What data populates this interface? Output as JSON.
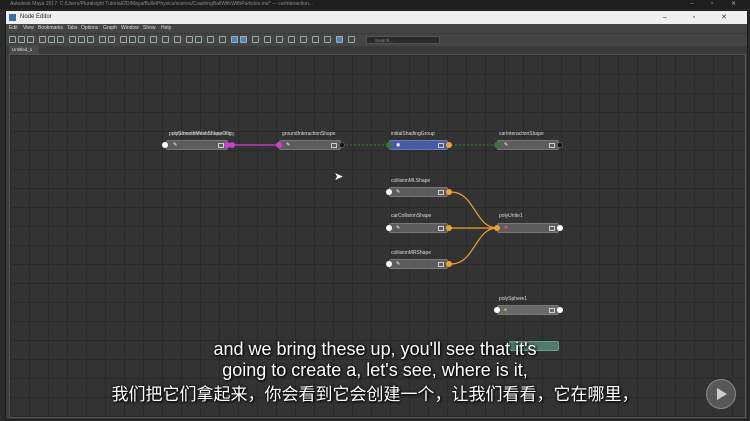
{
  "outer_window": {
    "title": "Autodesk Maya 2017: C:/Users/Pluralsight Tutorial/2D/Maya/BulletPhysics/scenes/CrashingBallWithWithParticles.ma* --- carInteraction..."
  },
  "node_editor": {
    "title": "Node Editor",
    "menu": [
      "Edit",
      "View",
      "Bookmarks",
      "Tabs",
      "Options",
      "Graph",
      "Window",
      "Show",
      "Help"
    ],
    "search": {
      "placeholder": "Search..."
    },
    "tab_label": "Untitled_1",
    "nodes": [
      {
        "label": "polySmoothMeshShapeOrig",
        "overlap_label": "polySmoothMeshShapeOrig",
        "icon": "mesh-icon"
      },
      {
        "label": "groundInteractionShape",
        "icon": "mesh-icon"
      },
      {
        "label": "initialShadingGroup",
        "icon": "shading-group-icon"
      },
      {
        "label": "carInteractionShape",
        "icon": "mesh-icon"
      },
      {
        "label": "collisionMLShape",
        "icon": "mesh-icon"
      },
      {
        "label": "carCollisionShape",
        "icon": "mesh-icon"
      },
      {
        "label": "collisionMRShape",
        "icon": "mesh-icon"
      },
      {
        "label": "polyUnite1",
        "icon": "poly-unite-icon"
      },
      {
        "label": "polySphere1",
        "icon": "poly-sphere-icon"
      }
    ]
  },
  "subtitles": {
    "line1": "and we bring these up, you'll see that it's",
    "line2": "going to create a, let's see, where is it,",
    "line3": "我们把它们拿起来，你会看到它会创建一个，让我们看看，它在哪里，"
  },
  "colors": {
    "wire_magenta": "#d040d0",
    "wire_orange": "#f0a030",
    "wire_green": "#2f7d2f",
    "node_blue": "#4a5aa0",
    "port_orange": "#f0a030"
  }
}
